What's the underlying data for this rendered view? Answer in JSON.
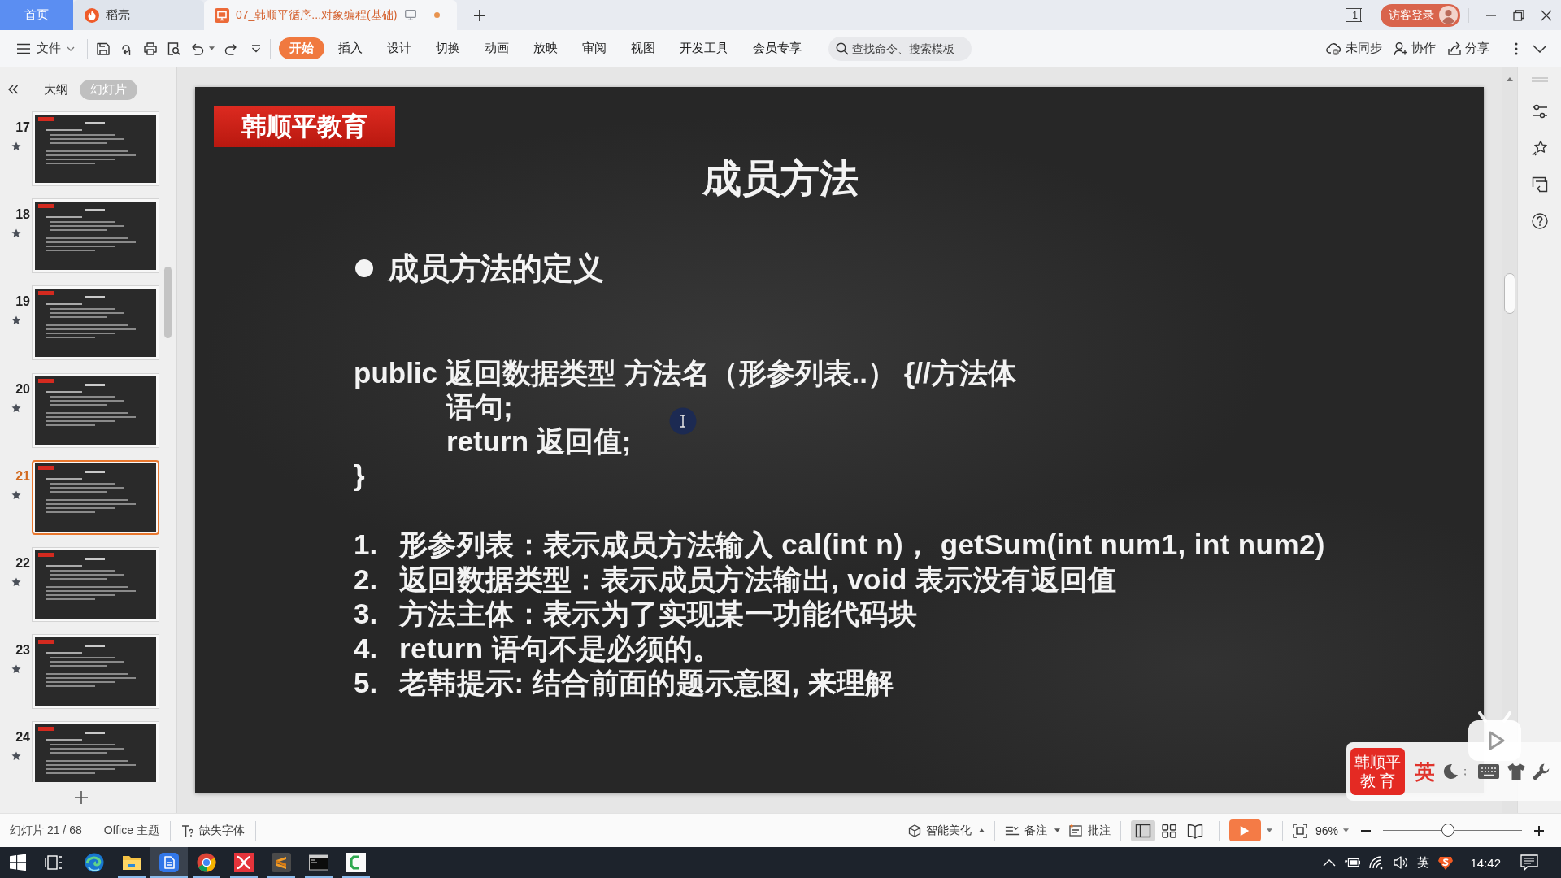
{
  "tab_bar": {
    "tabs": [
      {
        "kind": "home",
        "label": "首页",
        "selected": false
      },
      {
        "kind": "docer",
        "label": "稻壳",
        "selected": false
      },
      {
        "kind": "document",
        "label": "07_韩顺平循序...对象编程(基础)",
        "selected": true,
        "unsaved": true
      }
    ],
    "window_count": "1",
    "login": "访客登录"
  },
  "toolbar": {
    "file_menu": "文件",
    "ribbon_tabs": [
      {
        "label": "开始",
        "selected": true
      },
      {
        "label": "插入",
        "selected": false
      },
      {
        "label": "设计",
        "selected": false
      },
      {
        "label": "切换",
        "selected": false
      },
      {
        "label": "动画",
        "selected": false
      },
      {
        "label": "放映",
        "selected": false
      },
      {
        "label": "审阅",
        "selected": false
      },
      {
        "label": "视图",
        "selected": false
      },
      {
        "label": "开发工具",
        "selected": false
      },
      {
        "label": "会员专享",
        "selected": false
      }
    ],
    "search": {
      "placeholder": "查找命令、搜索模板"
    },
    "actions": [
      {
        "kind": "sync",
        "label": "未同步"
      },
      {
        "kind": "collaborate",
        "label": "协作"
      },
      {
        "kind": "share",
        "label": "分享"
      }
    ]
  },
  "slide_panel": {
    "tabs": [
      {
        "label": "大纲",
        "selected": false
      },
      {
        "label": "幻灯片",
        "selected": true
      }
    ],
    "slides": [
      {
        "number": "17",
        "selected": false,
        "animated": true
      },
      {
        "number": "18",
        "selected": false,
        "animated": true
      },
      {
        "number": "19",
        "selected": false,
        "animated": true
      },
      {
        "number": "20",
        "selected": false,
        "animated": true
      },
      {
        "number": "21",
        "selected": true,
        "animated": true
      },
      {
        "number": "22",
        "selected": false,
        "animated": true
      },
      {
        "number": "23",
        "selected": false,
        "animated": true
      },
      {
        "number": "24",
        "selected": false,
        "animated": true
      }
    ]
  },
  "slide": {
    "brand": "韩顺平教育",
    "title": "成员方法",
    "bullet": "成员方法的定义",
    "code": {
      "header": "public 返回数据类型 方法名（形参列表..） {//方法体",
      "body": [
        "语句;",
        "return 返回值;"
      ],
      "footer": "}"
    },
    "notes": [
      {
        "number": "1.",
        "text": "形参列表：表示成员方法输入 cal(int n)， getSum(int num1, int num2)"
      },
      {
        "number": "2.",
        "text": "返回数据类型：表示成员方法输出, void 表示没有返回值"
      },
      {
        "number": "3.",
        "text": "方法主体：表示为了实现某一功能代码块"
      },
      {
        "number": "4.",
        "text": "return 语句不是必须的。"
      },
      {
        "number": "5.",
        "text": "老韩提示: 结合前面的题示意图, 来理解"
      }
    ]
  },
  "status_bar": {
    "slide_counter": "幻灯片 21 / 68",
    "theme": "Office 主题",
    "missing_fonts": "缺失字体",
    "beautify": "智能美化",
    "notes": "备注",
    "comments": "批注",
    "views": [
      {
        "kind": "normal",
        "selected": true
      },
      {
        "kind": "sorter",
        "selected": false
      },
      {
        "kind": "reading",
        "selected": false
      }
    ],
    "zoom": {
      "reading": "96%",
      "level": 0.47
    }
  },
  "taskbar": {
    "apps": [
      {
        "kind": "browser_wave",
        "running": false,
        "selected": false
      },
      {
        "kind": "folder",
        "running": true,
        "selected": false
      },
      {
        "kind": "writer",
        "running": true,
        "selected": true
      },
      {
        "kind": "browser_ring",
        "running": true,
        "selected": false
      },
      {
        "kind": "mindmap",
        "running": true,
        "selected": false
      },
      {
        "kind": "editor",
        "running": true,
        "selected": false
      },
      {
        "kind": "terminal",
        "running": true,
        "selected": false
      },
      {
        "kind": "recorder",
        "running": true,
        "selected": false
      }
    ],
    "input_language": "英",
    "clock": "14:42"
  },
  "ime_toolbar": {
    "logo": [
      "韩顺平",
      "教 育"
    ],
    "mode": "英",
    "punctuation": "；"
  }
}
